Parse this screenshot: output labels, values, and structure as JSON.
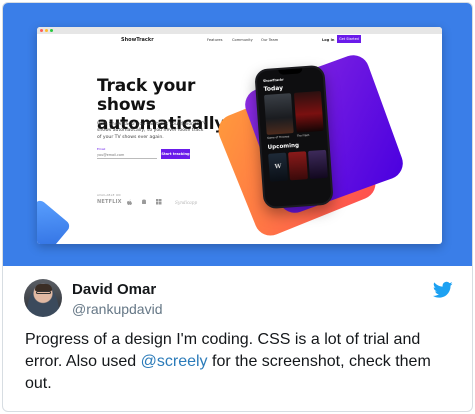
{
  "browser": {
    "logo": "ShowTrackr",
    "nav_links": [
      "Features",
      "Community",
      "Our Team"
    ],
    "login": "Log in",
    "cta": "Get Started"
  },
  "landing": {
    "headline_line1": "Track your shows",
    "headline_line2": "automatically",
    "description": "With ShowTrackr you can track your favorite TV shows automatically, so you never loose track of your TV shows ever again.",
    "email_label": "Email",
    "email_placeholder": "you@email.com",
    "button": "Start tracking",
    "available_label": "AVAILABLE ON",
    "logos": [
      "NETFLIX",
      "apple-icon",
      "android-icon",
      "windows-icon",
      "Syndicapp"
    ]
  },
  "phone": {
    "app_logo": "ShowTrackr",
    "today_title": "Today",
    "today_shows": [
      {
        "title": "Game of Thrones"
      },
      {
        "title": "The Flash"
      }
    ],
    "upcoming_title": "Upcoming",
    "upcoming_posters": [
      "W",
      "",
      ""
    ]
  },
  "tweet": {
    "name": "David Omar",
    "handle": "@rankupdavid",
    "text_before": "Progress of a design I'm coding. CSS is a lot of trial and error. Also used ",
    "mention": "@screely",
    "text_after": " for the screenshot, check them out."
  },
  "colors": {
    "hero_bg": "#3a7ee8",
    "accent_purple": "#6a1bea",
    "twitter_blue": "#1da1f2",
    "mention": "#2b7bb9"
  }
}
